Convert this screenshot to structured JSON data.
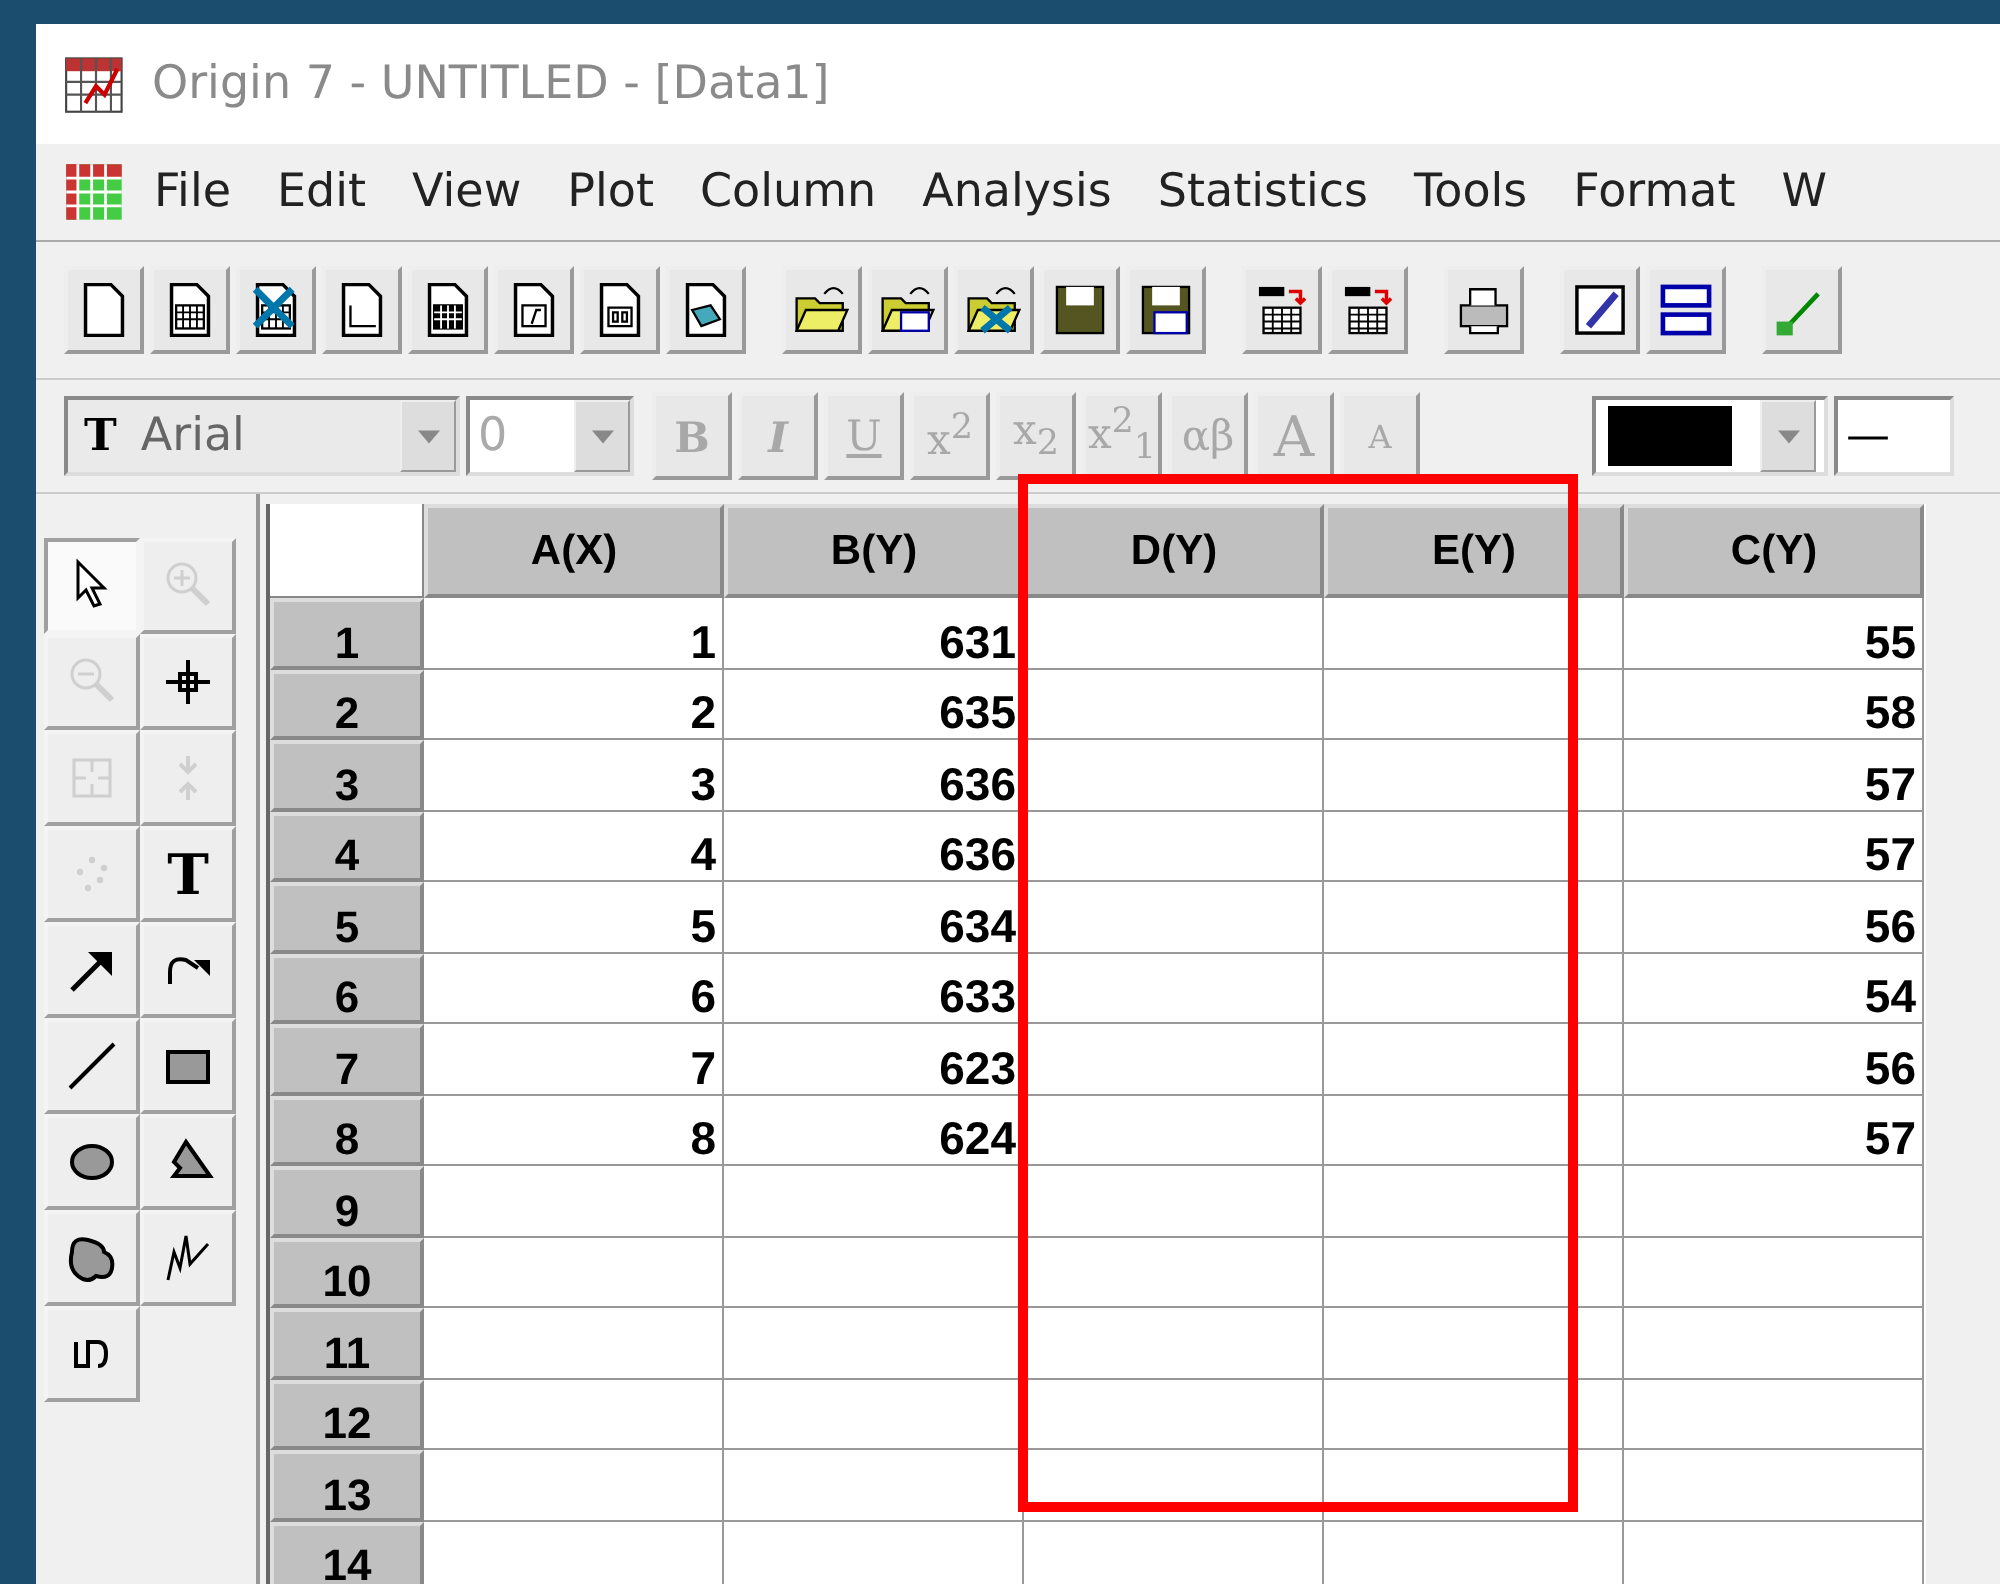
{
  "window": {
    "title": "Origin 7 - UNTITLED - [Data1]"
  },
  "menu": [
    "File",
    "Edit",
    "View",
    "Plot",
    "Column",
    "Analysis",
    "Statistics",
    "Tools",
    "Format",
    "W"
  ],
  "toolbar": [
    {
      "kind": "new"
    },
    {
      "kind": "worksheet"
    },
    {
      "kind": "excel"
    },
    {
      "kind": "graph"
    },
    {
      "kind": "matrix"
    },
    {
      "kind": "function"
    },
    {
      "kind": "layout"
    },
    {
      "kind": "notes"
    },
    {
      "kind": "sep"
    },
    {
      "kind": "open"
    },
    {
      "kind": "opentemplate"
    },
    {
      "kind": "openexcel"
    },
    {
      "kind": "save"
    },
    {
      "kind": "savetemplate"
    },
    {
      "kind": "sep"
    },
    {
      "kind": "import"
    },
    {
      "kind": "importmulti"
    },
    {
      "kind": "sep"
    },
    {
      "kind": "print"
    },
    {
      "kind": "sep"
    },
    {
      "kind": "pen"
    },
    {
      "kind": "panels"
    },
    {
      "kind": "sep"
    },
    {
      "kind": "tree"
    }
  ],
  "format_bar": {
    "font_glyph": "T",
    "font": "Arial",
    "size": "0",
    "buttons": [
      {
        "label": "B",
        "kind": "bold",
        "disabled": true
      },
      {
        "label": "I",
        "kind": "italic",
        "disabled": true
      },
      {
        "label": "U",
        "kind": "underline",
        "disabled": true
      },
      {
        "label": "x$^{2}$",
        "kind": "plain",
        "disabled": true
      },
      {
        "label": "x$_{2}$",
        "kind": "plain",
        "disabled": true
      },
      {
        "label": "x$^{2}$$_{1}$",
        "kind": "plain",
        "disabled": true
      },
      {
        "label": "αβ",
        "kind": "plain",
        "disabled": true
      },
      {
        "label": "A",
        "kind": "grow",
        "disabled": true
      },
      {
        "label": "A",
        "kind": "shrink",
        "disabled": true
      }
    ],
    "color": "#000000",
    "line": "—"
  },
  "tools": [
    {
      "kind": "pointer",
      "selected": true,
      "disabled": false
    },
    {
      "kind": "zoomin",
      "selected": false,
      "disabled": true
    },
    {
      "kind": "zoomout",
      "selected": false,
      "disabled": true
    },
    {
      "kind": "crosshair",
      "selected": false,
      "disabled": false
    },
    {
      "kind": "region",
      "selected": false,
      "disabled": true
    },
    {
      "kind": "mask",
      "selected": false,
      "disabled": true
    },
    {
      "kind": "dots",
      "selected": false,
      "disabled": true
    },
    {
      "kind": "text",
      "glyph": "T",
      "selected": false,
      "disabled": false
    },
    {
      "kind": "arrow",
      "selected": false,
      "disabled": false
    },
    {
      "kind": "curvearrow",
      "selected": false,
      "disabled": false
    },
    {
      "kind": "line",
      "selected": false,
      "disabled": false
    },
    {
      "kind": "rect",
      "selected": false,
      "disabled": false
    },
    {
      "kind": "ellipse",
      "selected": false,
      "disabled": false
    },
    {
      "kind": "polygon",
      "selected": false,
      "disabled": false
    },
    {
      "kind": "blob",
      "selected": false,
      "disabled": false
    },
    {
      "kind": "polyline",
      "selected": false,
      "disabled": false
    },
    {
      "kind": "freehand",
      "selected": false,
      "disabled": false
    }
  ],
  "table": {
    "columns": [
      "A(X)",
      "B(Y)",
      "D(Y)",
      "E(Y)",
      "C(Y)"
    ],
    "rows": [
      {
        "label": "1",
        "cells": [
          "1",
          "631",
          null,
          null,
          "55"
        ]
      },
      {
        "label": "2",
        "cells": [
          "2",
          "635",
          null,
          null,
          "58"
        ]
      },
      {
        "label": "3",
        "cells": [
          "3",
          "636",
          null,
          null,
          "57"
        ]
      },
      {
        "label": "4",
        "cells": [
          "4",
          "636",
          null,
          null,
          "57"
        ]
      },
      {
        "label": "5",
        "cells": [
          "5",
          "634",
          null,
          null,
          "56"
        ]
      },
      {
        "label": "6",
        "cells": [
          "6",
          "633",
          null,
          null,
          "54"
        ]
      },
      {
        "label": "7",
        "cells": [
          "7",
          "623",
          null,
          null,
          "56"
        ]
      },
      {
        "label": "8",
        "cells": [
          "8",
          "624",
          null,
          null,
          "57"
        ]
      },
      {
        "label": "9"
      },
      {
        "label": "10"
      },
      {
        "label": "11"
      },
      {
        "label": "12"
      },
      {
        "label": "13"
      },
      {
        "label": "14"
      }
    ]
  },
  "highlight": {
    "color": "#ff0000"
  }
}
